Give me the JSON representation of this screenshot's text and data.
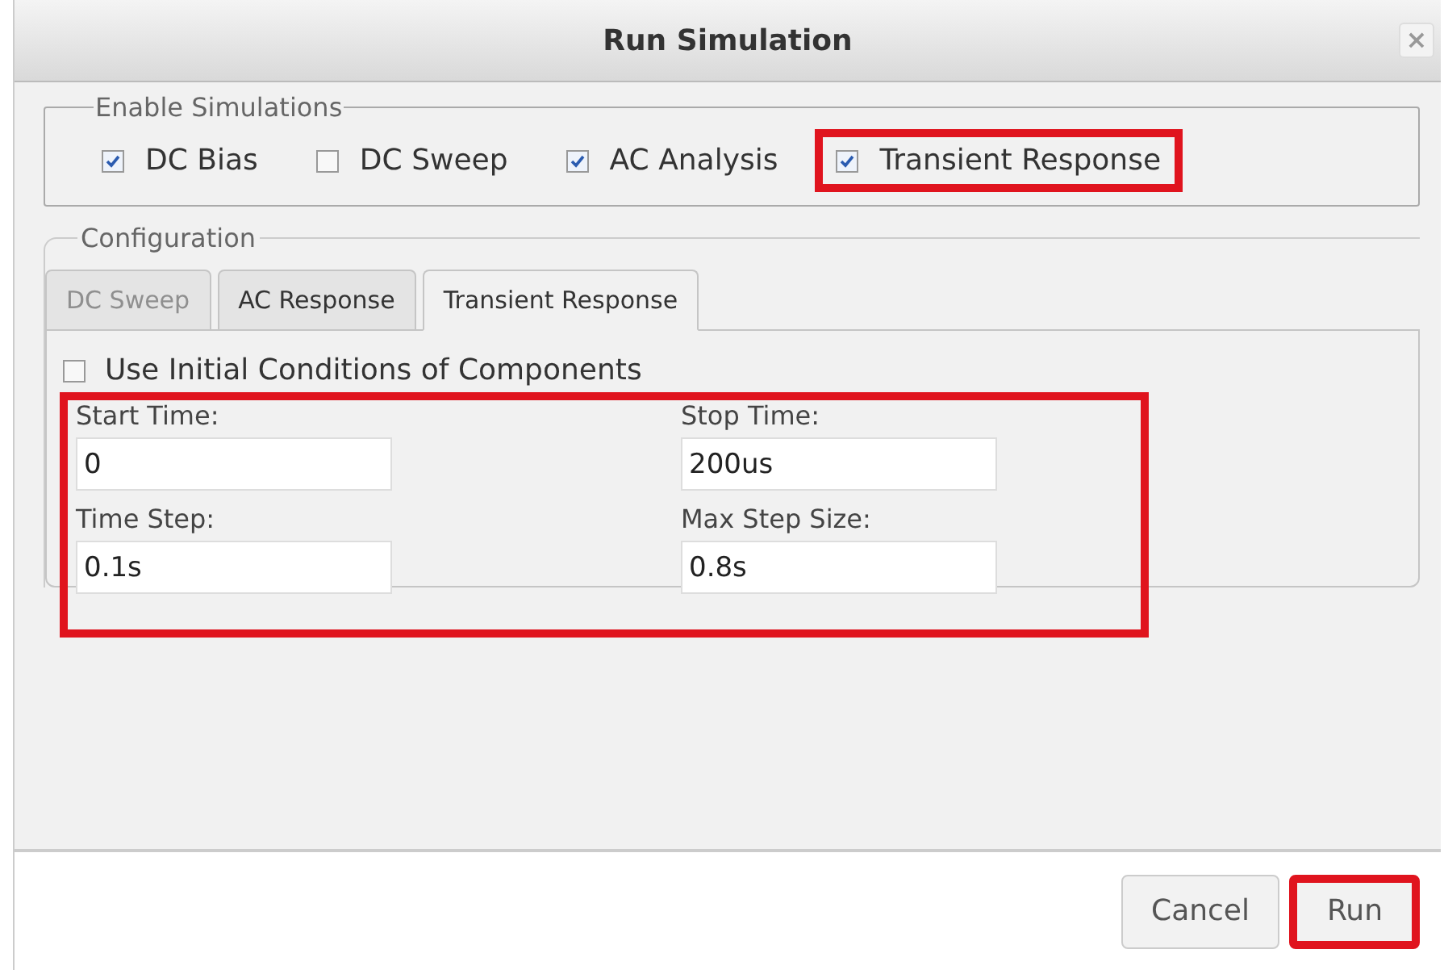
{
  "window": {
    "title": "Run Simulation",
    "close": "×"
  },
  "enable_simulations": {
    "legend": "Enable Simulations",
    "items": [
      {
        "label": "DC Bias",
        "checked": true,
        "highlighted": false
      },
      {
        "label": "DC Sweep",
        "checked": false,
        "highlighted": false
      },
      {
        "label": "AC Analysis",
        "checked": true,
        "highlighted": false
      },
      {
        "label": "Transient Response",
        "checked": true,
        "highlighted": true
      }
    ]
  },
  "configuration": {
    "legend": "Configuration",
    "tabs": [
      {
        "label": "DC Sweep",
        "selected": false,
        "disabled": true
      },
      {
        "label": "AC Response",
        "selected": false,
        "disabled": false
      },
      {
        "label": "Transient Response",
        "selected": true,
        "disabled": false
      }
    ],
    "use_initial_conditions": {
      "label": "Use Initial Conditions of Components",
      "checked": false
    },
    "fields_highlighted": true,
    "fields": [
      {
        "label": "Start Time:",
        "value": "0"
      },
      {
        "label": "Stop Time:",
        "value": "200us"
      },
      {
        "label": "Time Step:",
        "value": "0.1s"
      },
      {
        "label": "Max Step Size:",
        "value": "0.8s"
      }
    ]
  },
  "buttons": [
    {
      "label": "Cancel",
      "highlighted": false
    },
    {
      "label": "Run",
      "highlighted": true
    }
  ]
}
